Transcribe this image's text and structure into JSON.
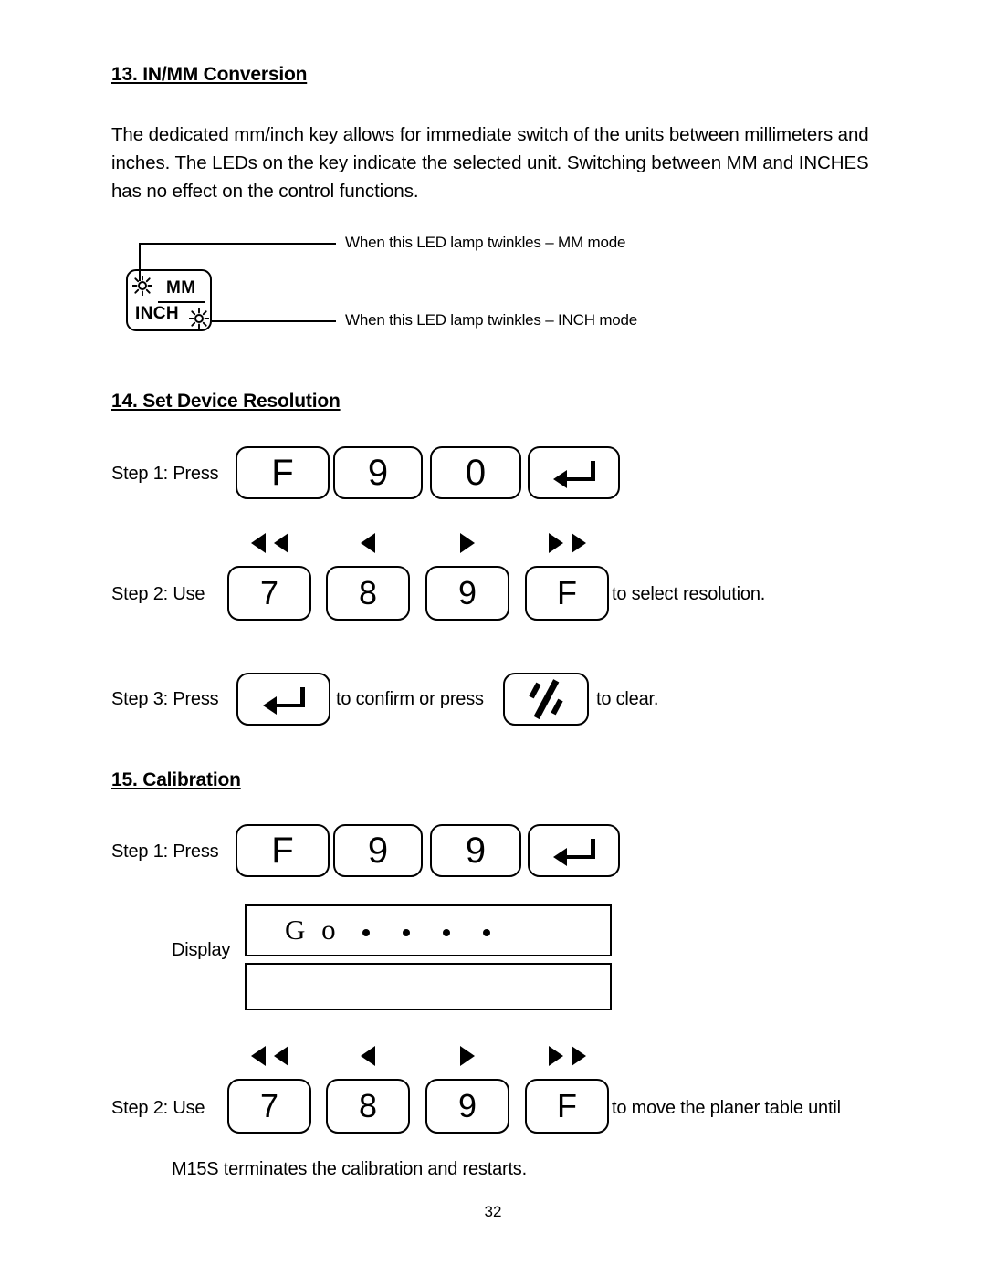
{
  "document": {
    "page_number": "32"
  },
  "section13": {
    "heading": "13. IN/MM Conversion",
    "paragraph": "The dedicated mm/inch key allows for immediate switch of the units between millimeters and inches. The LEDs on the key indicate the selected unit. Switching between MM and INCHES has no effect on the control functions.",
    "key": {
      "mm_label": "MM",
      "inch_label": "INCH"
    },
    "annotations": [
      "When this LED lamp twinkles – MM mode",
      "When this LED lamp twinkles – INCH mode"
    ]
  },
  "section14": {
    "heading": "14. Set Device Resolution",
    "step1": {
      "label": "Step 1: Press",
      "keys": [
        "F",
        "9",
        "0",
        "enter-icon"
      ]
    },
    "step2": {
      "label": "Step 2: Use",
      "keys": [
        "7",
        "8",
        "9",
        "F"
      ],
      "arrows": [
        "double-left-arrow-icon",
        "single-left-arrow-icon",
        "single-right-arrow-icon",
        "double-right-arrow-icon"
      ],
      "trailing_text": "to select resolution."
    },
    "step3": {
      "label": "Step 3: Press",
      "enter_key": "enter-icon",
      "middle_text": "to confirm or press",
      "clear_key": "clear-icon",
      "trailing_text": "to clear."
    }
  },
  "section15": {
    "heading": "15. Calibration",
    "step1": {
      "label": "Step 1: Press",
      "keys": [
        "F",
        "9",
        "9",
        "enter-icon"
      ]
    },
    "display": {
      "label": "Display",
      "line1_text": "G o",
      "line1_dots": 4,
      "line2_text": ""
    },
    "step2": {
      "label": "Step 2: Use",
      "keys": [
        "7",
        "8",
        "9",
        "F"
      ],
      "arrows": [
        "double-left-arrow-icon",
        "single-left-arrow-icon",
        "single-right-arrow-icon",
        "double-right-arrow-icon"
      ],
      "trailing_text": "to move the planer table until"
    },
    "closing_text": "M15S terminates the calibration and restarts."
  },
  "colors": {
    "ink": "#000000",
    "paper": "#ffffff"
  }
}
